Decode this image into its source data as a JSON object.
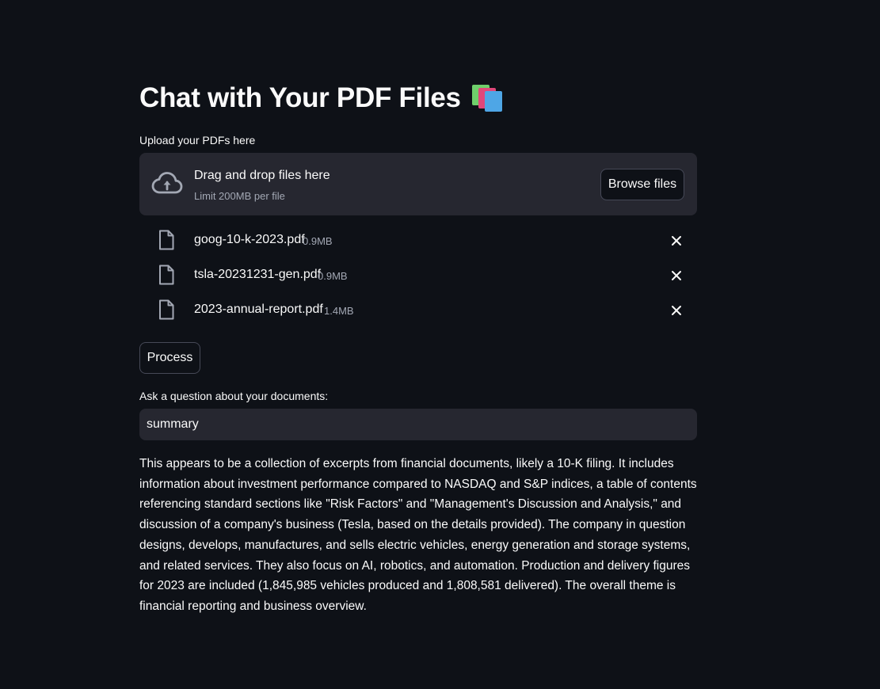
{
  "page": {
    "title": "Chat with Your PDF Files",
    "title_icon": "books-emoji-icon"
  },
  "uploader": {
    "label": "Upload your PDFs here",
    "dropzone_title": "Drag and drop files here",
    "dropzone_limit": "Limit 200MB per file",
    "browse_label": "Browse files",
    "icon": "cloud-upload-icon"
  },
  "files": [
    {
      "name": "goog-10-k-2023.pdf",
      "size": "0.9MB",
      "icon": "file-icon"
    },
    {
      "name": "tsla-20231231-gen.pdf",
      "size": "0.9MB",
      "icon": "file-icon"
    },
    {
      "name": "2023-annual-report.pdf",
      "size": "1.4MB",
      "icon": "file-icon"
    }
  ],
  "process_label": "Process",
  "question": {
    "label": "Ask a question about your documents:",
    "value": "summary"
  },
  "answer": "This appears to be a collection of excerpts from financial documents, likely a 10-K filing. It includes information about investment performance compared to NASDAQ and S&P indices, a table of contents referencing standard sections like \"Risk Factors\" and \"Management's Discussion and Analysis,\" and discussion of a company's business (Tesla, based on the details provided). The company in question designs, develops, manufactures, and sells electric vehicles, energy generation and storage systems, and related services. They also focus on AI, robotics, and automation. Production and delivery figures for 2023 are included (1,845,985 vehicles produced and 1,808,581 delivered). The overall theme is financial reporting and business overview.",
  "colors": {
    "background": "#0e1117",
    "surface": "#262730",
    "text": "#fafafa",
    "muted": "#a3a8b4",
    "border": "#464957"
  }
}
